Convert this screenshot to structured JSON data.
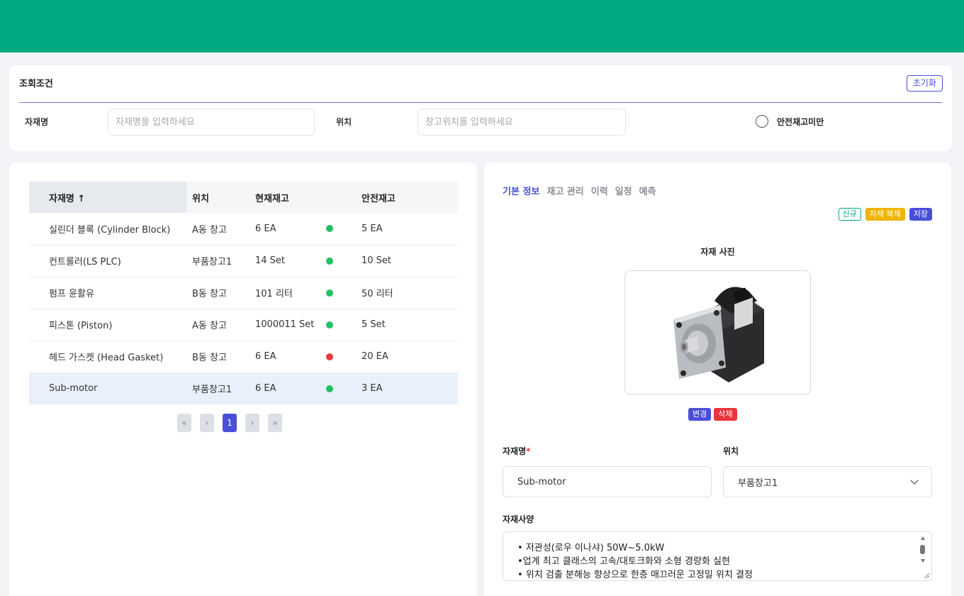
{
  "search": {
    "title": "조회조건",
    "reset_label": "초기화",
    "name_label": "자재명",
    "name_placeholder": "자재명을 입력하세요",
    "location_label": "위치",
    "location_placeholder": "창고위치를 입력하세요",
    "safety_only_label": "안전재고미만"
  },
  "table": {
    "headers": {
      "name": "자재명 ↑",
      "location": "위치",
      "current": "현재재고",
      "safety": "안전재고"
    },
    "rows": [
      {
        "name": "실린더 블록 (Cylinder Block)",
        "location": "A동 창고",
        "current": "6 EA",
        "status": "ok",
        "safety": "5 EA"
      },
      {
        "name": "컨트롤러(LS PLC)",
        "location": "부품창고1",
        "current": "14 Set",
        "status": "ok",
        "safety": "10 Set"
      },
      {
        "name": "펌프 윤활유",
        "location": "B동 창고",
        "current": "101 리터",
        "status": "ok",
        "safety": "50 리터"
      },
      {
        "name": "피스톤 (Piston)",
        "location": "A동 창고",
        "current": "1000011 Set",
        "status": "ok",
        "safety": "5 Set"
      },
      {
        "name": "헤드 가스켓 (Head Gasket)",
        "location": "B동 창고",
        "current": "6 EA",
        "status": "low",
        "safety": "20 EA"
      },
      {
        "name": "Sub-motor",
        "location": "부품창고1",
        "current": "6 EA",
        "status": "ok",
        "safety": "3 EA"
      }
    ],
    "selected_index": 5
  },
  "pagination": {
    "first": "«",
    "prev": "‹",
    "current_page": "1",
    "next": "›",
    "last": "»"
  },
  "detail": {
    "tabs": [
      {
        "label": "기본 정보",
        "active": true
      },
      {
        "label": "재고 관리",
        "active": false
      },
      {
        "label": "이력",
        "active": false
      },
      {
        "label": "일정",
        "active": false
      },
      {
        "label": "예측",
        "active": false
      }
    ],
    "actions": {
      "new_label": "신규",
      "copy_label": "자재 복제",
      "save_label": "저장"
    },
    "photo": {
      "title": "자재 사진",
      "image_icon": "servo-motor-photo",
      "change_label": "변경",
      "delete_label": "삭제"
    },
    "name_label": "자재명",
    "name_required_mark": "*",
    "name_value": "Sub-motor",
    "location_label": "위치",
    "location_value": "부품창고1",
    "spec_label": "자재사양",
    "spec_lines": [
      "• 저관성(로우 이나샤) 50W~5.0kW",
      "•업계 최고 클래스의 고속/대토크화와 소형 경량화 실현",
      "• 위치 검출 분해능 향상으로 한층 매끄러운 고정밀 위치 결정"
    ]
  },
  "colors": {
    "brand": "#00a982",
    "accent": "#4a4fd9",
    "ok": "#22c064",
    "low": "#ea3a3a",
    "copy": "#f0b400",
    "delete": "#e8343a"
  }
}
